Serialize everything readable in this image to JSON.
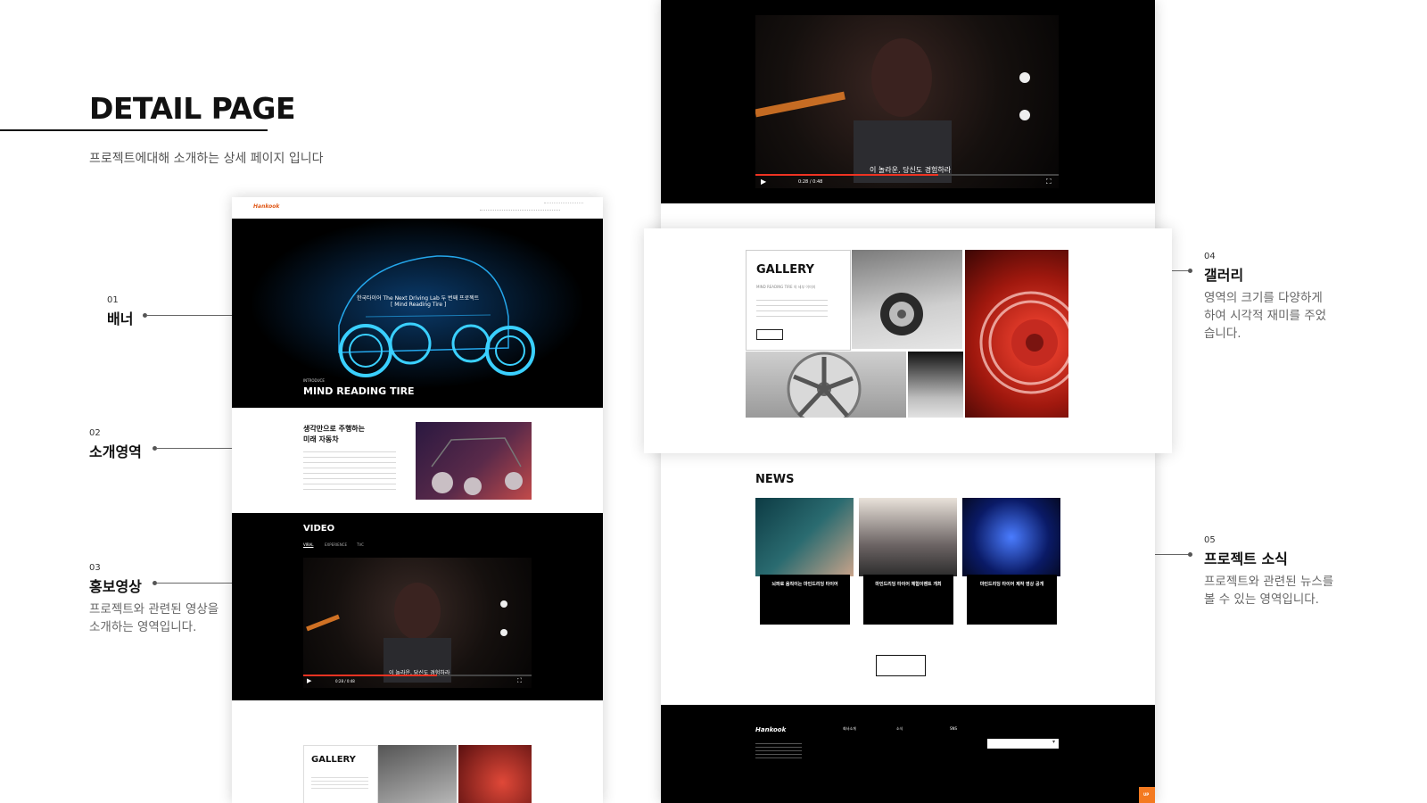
{
  "header": {
    "title": "DETAIL PAGE",
    "subtitle": "프로젝트에대해 소개하는 상세 페이지 입니다"
  },
  "callouts": [
    {
      "num": "01",
      "label": "배너",
      "desc": ""
    },
    {
      "num": "02",
      "label": "소개영역",
      "desc": ""
    },
    {
      "num": "03",
      "label": "홍보영상",
      "desc": "프로젝트와 관련된 영상을 소개하는 영역입니다."
    },
    {
      "num": "04",
      "label": "갤러리",
      "desc": "영역의 크기를 다양하게 하여 시각적 재미를 주었습니다."
    },
    {
      "num": "05",
      "label": "프로젝트 소식",
      "desc": "프로젝트와 관련된 뉴스를 볼 수 있는 영역입니다."
    }
  ],
  "left_mock": {
    "logo": "Hankook",
    "nav": [
      "",
      "",
      "",
      ""
    ],
    "banner": {
      "caption_line1": "한국타이어 The Next Driving Lab 두 번째 프로젝트",
      "caption_line2": "[ Mind Reading Tire ]",
      "kicker": "INTRODUCE",
      "title": "MIND READING TIRE"
    },
    "intro": {
      "heading_line1": "생각만으로 주행하는",
      "heading_line2": "미래 자동차"
    },
    "video": {
      "title": "VIDEO",
      "tabs": [
        "VIRAL",
        "EXPERIENCE",
        "TVC"
      ],
      "subtitle_text": "이 놀라운, 당신도 경험하라",
      "time": "0:28 / 0:48"
    },
    "gallery": {
      "title": "GALLERY"
    }
  },
  "right_mock": {
    "video": {
      "subtitle_text": "이 놀라운, 당신도 경험하라",
      "time": "0:28 / 0:48"
    },
    "gallery": {
      "title": "GALLERY",
      "kicker": "MIND READING TIRE 의 세부 이미지"
    },
    "news": {
      "title": "NEWS",
      "items": [
        {
          "title": "뇌파로 움직이는 마인드리딩 타이어"
        },
        {
          "title": "마인드리딩 타이어 체험이벤트 개최"
        },
        {
          "title": "마인드리딩 타이어 제작 영상 공개"
        }
      ]
    },
    "footer": {
      "logo": "Hankook",
      "cols": [
        "회사소개",
        "소식",
        "SNS"
      ],
      "up": "UP"
    }
  },
  "colors": {
    "accent": "#f47a20",
    "dark": "#000000",
    "text": "#111111"
  }
}
